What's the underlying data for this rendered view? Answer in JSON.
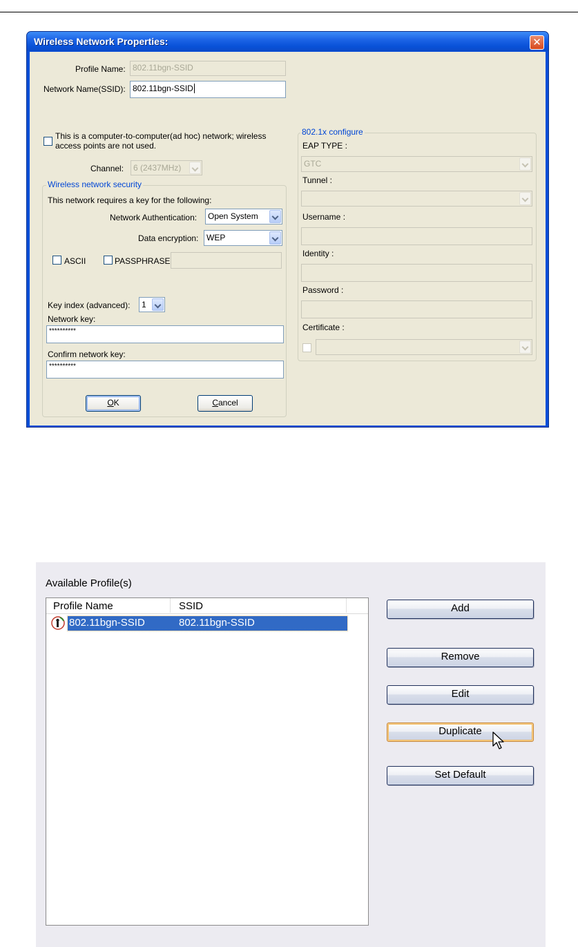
{
  "dialog": {
    "title": "Wireless Network Properties:",
    "close_glyph": "✕",
    "profile_name_label": "Profile Name:",
    "profile_name_value": "802.11bgn-SSID",
    "ssid_label": "Network Name(SSID):",
    "ssid_value": "802.11bgn-SSID",
    "adhoc_label_line1": "This is a computer-to-computer(ad hoc) network; wireless",
    "adhoc_label_line2": "access points are not used.",
    "channel_label": "Channel:",
    "channel_value": "6  (2437MHz)",
    "security": {
      "legend": "Wireless network security",
      "intro": "This network requires a key for the following:",
      "auth_label": "Network Authentication:",
      "auth_value": "Open System",
      "encryption_label": "Data encryption:",
      "encryption_value": "WEP",
      "ascii_label": "ASCII",
      "passphrase_label": "PASSPHRASE",
      "key_index_label": "Key index (advanced):",
      "key_index_value": "1",
      "network_key_label": "Network key:",
      "network_key_value": "**********",
      "confirm_key_label": "Confirm network key:",
      "confirm_key_value": "**********"
    },
    "eap": {
      "legend": "802.1x configure",
      "eap_type_label": "EAP TYPE :",
      "eap_type_value": "GTC",
      "tunnel_label": "Tunnel :",
      "tunnel_value": "",
      "username_label": "Username :",
      "identity_label": "Identity :",
      "password_label": "Password :",
      "certificate_label": "Certificate :"
    },
    "ok_label": "OK",
    "ok_mnemonic": "O",
    "ok_rest": "K",
    "cancel_mnemonic": "C",
    "cancel_rest": "ancel"
  },
  "profiles": {
    "title": "Available Profile(s)",
    "columns": [
      "Profile Name",
      "SSID"
    ],
    "rows": [
      {
        "profile_name": "802.11bgn-SSID",
        "ssid": "802.11bgn-SSID"
      }
    ],
    "buttons": {
      "add": "Add",
      "remove": "Remove",
      "edit": "Edit",
      "duplicate": "Duplicate",
      "set_default": "Set Default"
    }
  }
}
